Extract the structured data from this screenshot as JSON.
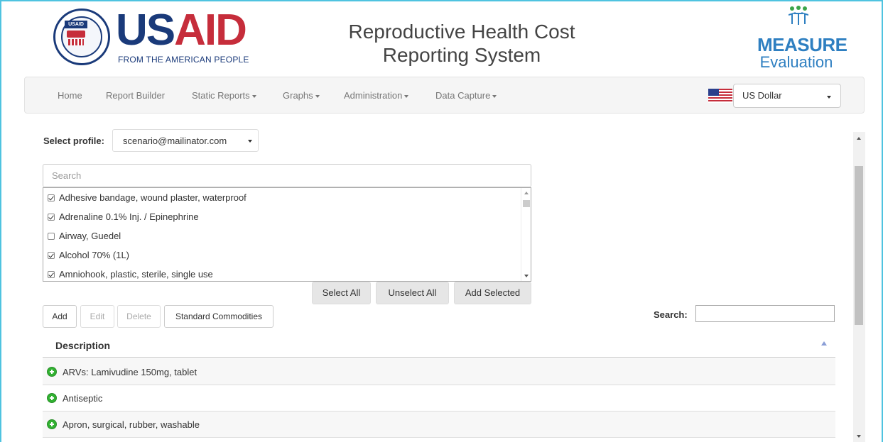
{
  "header": {
    "usaid": {
      "badge": "USAID",
      "word_us": "US",
      "word_aid": "AID",
      "tagline": "FROM THE AMERICAN PEOPLE"
    },
    "title_line1": "Reproductive Health Cost",
    "title_line2": "Reporting System",
    "measure": {
      "word": "MEASURE",
      "sub": "Evaluation"
    }
  },
  "nav": {
    "items": [
      {
        "label": "Home",
        "dropdown": false
      },
      {
        "label": "Report Builder",
        "dropdown": false
      },
      {
        "label": "Static Reports",
        "dropdown": true
      },
      {
        "label": "Graphs",
        "dropdown": true
      },
      {
        "label": "Administration",
        "dropdown": true
      },
      {
        "label": "Data Capture",
        "dropdown": true
      }
    ],
    "flag_icon": "us-flag-icon",
    "currency": "US Dollar"
  },
  "profile": {
    "label": "Select profile:",
    "value": "scenario@mailinator.com"
  },
  "picker": {
    "search_placeholder": "Search",
    "items": [
      {
        "label": "Adhesive bandage, wound plaster, waterproof",
        "checked": true
      },
      {
        "label": "Adrenaline 0.1% Inj. / Epinephrine",
        "checked": true
      },
      {
        "label": "Airway, Guedel",
        "checked": false
      },
      {
        "label": "Alcohol 70% (1L)",
        "checked": true
      },
      {
        "label": "Amniohook, plastic, sterile, single use",
        "checked": true
      }
    ],
    "select_all": "Select All",
    "unselect_all": "Unselect All",
    "add_selected": "Add Selected"
  },
  "toolbar": {
    "add": "Add",
    "edit": "Edit",
    "delete": "Delete",
    "standard_commodities": "Standard Commodities",
    "search_label": "Search:",
    "search_value": ""
  },
  "table": {
    "header": "Description",
    "rows": [
      "ARVs: Lamivudine 150mg, tablet",
      "Antiseptic",
      "Apron, surgical, rubber, washable"
    ]
  },
  "colors": {
    "usaid_blue": "#1a3a7a",
    "usaid_red": "#c62d3b",
    "measure_blue": "#2e7fc1",
    "expand_green": "#31b131",
    "frame_cyan": "#4fc3e0"
  }
}
